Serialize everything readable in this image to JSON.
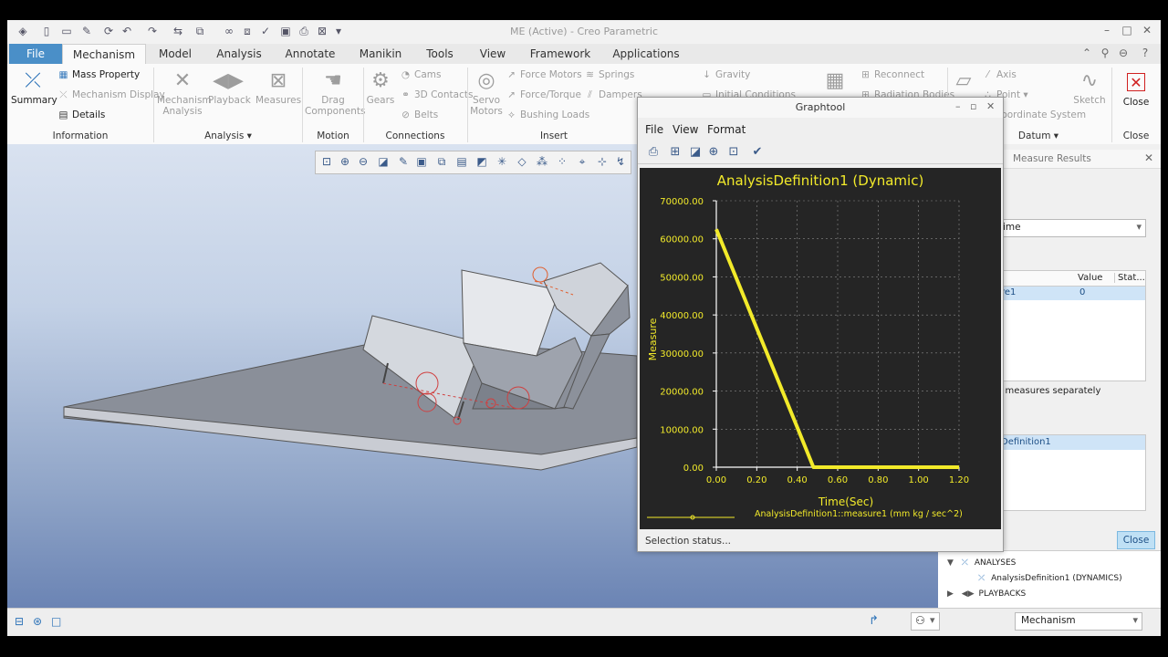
{
  "window": {
    "title": "ME (Active) - Creo Parametric"
  },
  "tabs": [
    "File",
    "Mechanism",
    "Model",
    "Analysis",
    "Annotate",
    "Manikin",
    "Tools",
    "View",
    "Framework",
    "Applications"
  ],
  "ribbon": {
    "information": {
      "label": "Information",
      "summary": "Summary",
      "mass_property": "Mass Property",
      "mechanism_display": "Mechanism Display",
      "details": "Details"
    },
    "analysis": {
      "label": "Analysis",
      "mechanism_analysis_1": "Mechanism",
      "mechanism_analysis_2": "Analysis",
      "playback": "Playback",
      "measures": "Measures"
    },
    "motion": {
      "label": "Motion",
      "drag_1": "Drag",
      "drag_2": "Components"
    },
    "connections": {
      "label": "Connections",
      "gears": "Gears",
      "cams": "Cams",
      "contacts_3d": "3D Contacts",
      "belts": "Belts"
    },
    "insert": {
      "label": "Insert",
      "servo_1": "Servo",
      "servo_2": "Motors",
      "force_motors": "Force Motors",
      "force_torque": "Force/Torque",
      "bushing_loads": "Bushing Loads",
      "springs": "Springs",
      "dampers": "Dampers",
      "gravity": "Gravity",
      "initial_conditions": "Initial Conditions"
    },
    "misc": {
      "reconnect": "Reconnect",
      "radiation_bodies": "Radiation Bodies",
      "axis": "Axis",
      "point": "Point",
      "coordinate_system": "Coordinate System",
      "sketch": "Sketch",
      "datum_label": "Datum",
      "close": "Close",
      "close_label": "Close"
    }
  },
  "measure_results": {
    "title": "Measure Results",
    "dropdown_value": "ime",
    "col_value": "Value",
    "col_status": "Stat...",
    "row_name": "re1",
    "row_value": "0",
    "separately_text": "h measures separately",
    "analysis_item": "Definition1",
    "close_button": "Close"
  },
  "tree": {
    "analyses": "ANALYSES",
    "analysis_def": "AnalysisDefinition1 (DYNAMICS)",
    "playbacks": "PLAYBACKS"
  },
  "graphtool": {
    "title": "Graphtool",
    "menu": [
      "File",
      "View",
      "Format"
    ],
    "status": "Selection status..."
  },
  "bottom": {
    "mode_select": "Mechanism"
  },
  "chart_data": {
    "type": "line",
    "title": "AnalysisDefinition1 (Dynamic)",
    "xlabel": "Time(Sec)",
    "ylabel": "Measure",
    "legend": "AnalysisDefinition1::measure1 (mm kg / sec^2)",
    "xlim": [
      0,
      1.2
    ],
    "ylim": [
      0,
      70000
    ],
    "x_ticks": [
      "0.00",
      "0.20",
      "0.40",
      "0.60",
      "0.80",
      "1.00",
      "1.20"
    ],
    "y_ticks": [
      "0.00",
      "10000.00",
      "20000.00",
      "30000.00",
      "40000.00",
      "50000.00",
      "60000.00",
      "70000.00"
    ],
    "grid": true,
    "colors": {
      "background": "#252525",
      "series": "#f2ea2a",
      "text": "#f2ea2a",
      "axis": "#ffffff"
    },
    "series": [
      {
        "x": [
          0.0,
          0.1,
          0.2,
          0.3,
          0.4,
          0.48,
          0.6,
          0.8,
          1.0,
          1.2
        ],
        "y": [
          62500,
          49500,
          36500,
          23500,
          10500,
          0,
          0,
          0,
          0,
          0
        ]
      }
    ]
  }
}
